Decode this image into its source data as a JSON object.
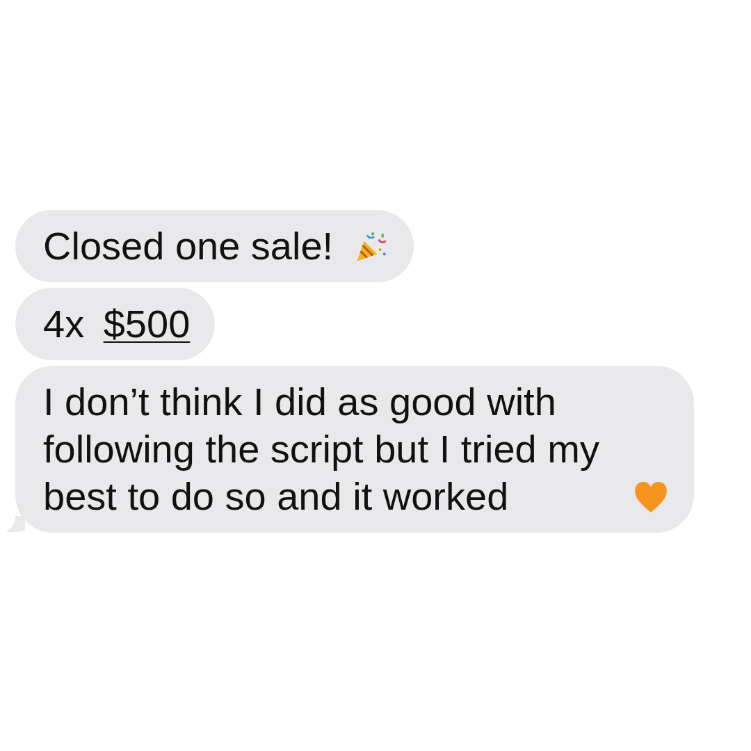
{
  "messages": [
    {
      "tail": false,
      "segments": [
        {
          "kind": "text",
          "text": "Closed one sale! "
        },
        {
          "kind": "popper"
        }
      ]
    },
    {
      "tail": false,
      "segments": [
        {
          "kind": "text",
          "text": "4x "
        },
        {
          "kind": "link",
          "text": "$500"
        }
      ]
    },
    {
      "tail": true,
      "segments": [
        {
          "kind": "text",
          "text": "I don’t think I did as good with following the script but I tried my best to do so and it worked "
        },
        {
          "kind": "heart"
        }
      ]
    }
  ]
}
